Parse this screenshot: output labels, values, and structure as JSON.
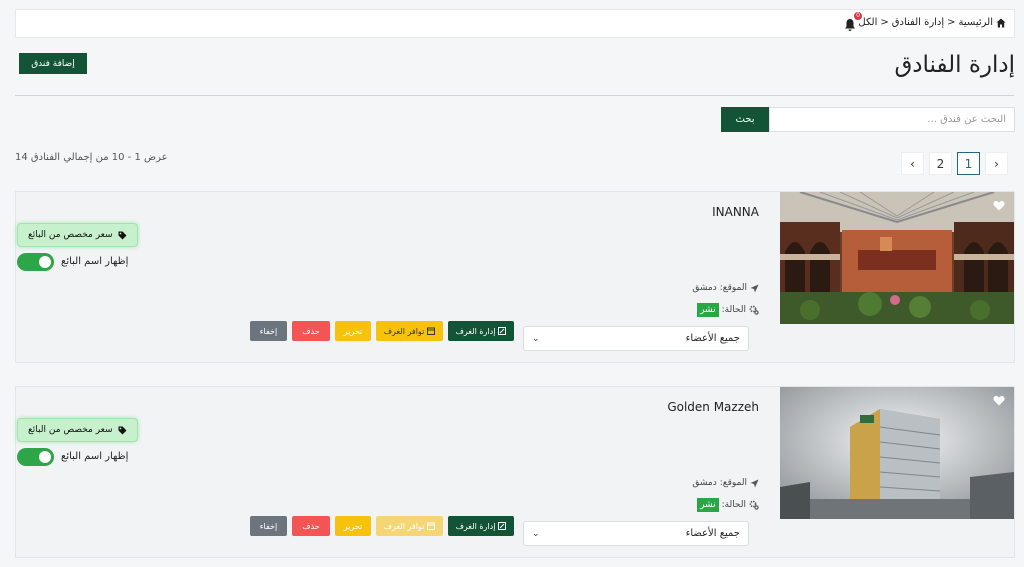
{
  "breadcrumb": {
    "home": "الرئيسية",
    "hotels": "إدارة الفنادق",
    "all": "الكل",
    "sep": "<"
  },
  "notifications": {
    "count": "0"
  },
  "header": {
    "add_label": "إضافة فندق",
    "title": "إدارة الفنادق"
  },
  "search": {
    "placeholder": "البحث عن فندق ...",
    "button": "بحث"
  },
  "results": {
    "text": "عرض 1 - 10 من إجمالي الفنادق 14"
  },
  "pagination": {
    "prev": "‹",
    "pages": [
      "1",
      "2"
    ],
    "next": "›",
    "active": "1"
  },
  "hotels": [
    {
      "name": "INANNA",
      "price_badge": "سعر مخصص من البائع",
      "show_seller_label": "إظهار اسم البائع",
      "location_label": "الموقع:",
      "location": "دمشق",
      "status_label": "الحالة:",
      "status": "نشر",
      "member_select": "جميع الأعضاء",
      "actions": {
        "rooms": "إدارة الغرف",
        "availability": "توافر الغرف",
        "edit": "تحرير",
        "delete": "حذف",
        "hide": "إخفاء"
      }
    },
    {
      "name": "Golden Mazzeh",
      "price_badge": "سعر مخصص من البائع",
      "show_seller_label": "إظهار اسم البائع",
      "location_label": "الموقع:",
      "location": "دمشق",
      "status_label": "الحالة:",
      "status": "نشر",
      "member_select": "جميع الأعضاء",
      "actions": {
        "rooms": "إدارة الغرف",
        "availability": "توافر الغرف",
        "edit": "تحرير",
        "delete": "حذف",
        "hide": "إخفاء"
      }
    }
  ],
  "colors": {
    "primary": "#135436",
    "success": "#28a745",
    "danger": "#f35454",
    "warning": "#f7c20d",
    "secondary": "#6c757d"
  }
}
